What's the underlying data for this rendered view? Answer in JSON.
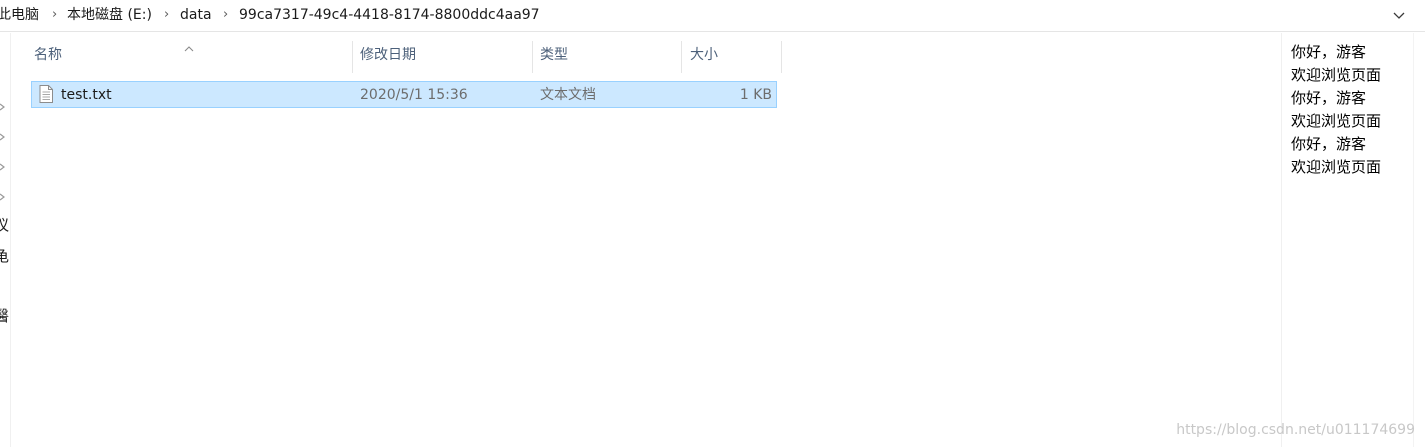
{
  "address_bar": {
    "crumbs": [
      "此电脑",
      "本地磁盘 (E:)",
      "data",
      "99ca7317-49c4-4418-8174-8800ddc4aa97"
    ],
    "separator": "›",
    "dropdown_icon": "chevron-down-icon"
  },
  "nav_pane": {
    "partial_labels": [
      "议",
      "龟",
      "醫"
    ]
  },
  "columns": {
    "name": "名称",
    "date_modified": "修改日期",
    "type": "类型",
    "size": "大小",
    "sort_indicator": "^"
  },
  "files": [
    {
      "name": "test.txt",
      "date_modified": "2020/5/1 15:36",
      "type": "文本文档",
      "size": "1 KB",
      "icon": "text-file-icon",
      "selected": true
    }
  ],
  "preview": {
    "lines": [
      "你好，游客",
      "欢迎浏览页面",
      "你好，游客",
      "欢迎浏览页面",
      "你好，游客",
      "欢迎浏览页面"
    ]
  },
  "watermark": "https://blog.csdn.net/u011174699",
  "colors": {
    "selection_bg": "#cce8ff",
    "selection_border": "#99d1ff",
    "header_text": "#4c607a",
    "secondary_text": "#6d6d6d"
  }
}
